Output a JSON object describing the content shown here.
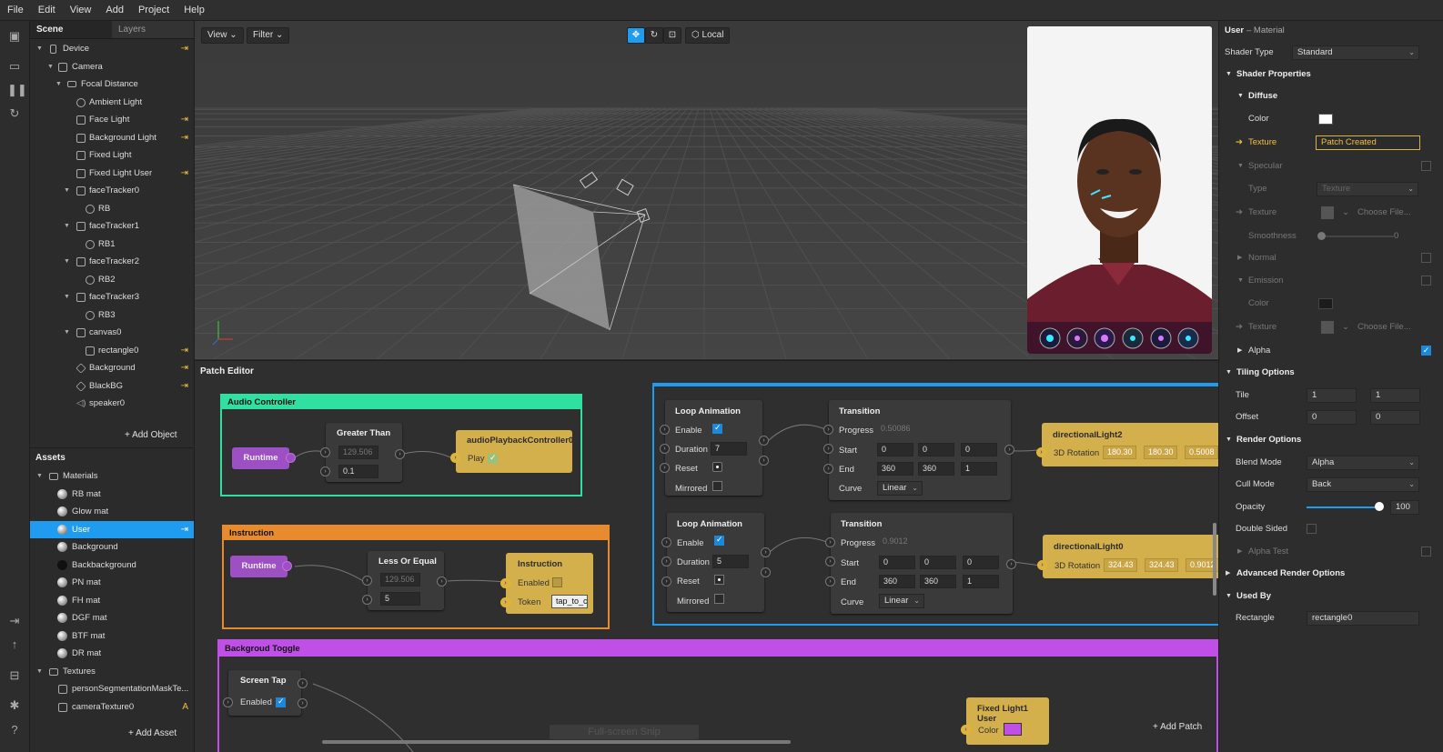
{
  "menu": [
    "File",
    "Edit",
    "View",
    "Add",
    "Project",
    "Help"
  ],
  "scene": {
    "tabs": [
      "Scene",
      "Layers"
    ],
    "items": [
      {
        "label": "Device",
        "pin": true
      },
      {
        "label": "Camera"
      },
      {
        "label": "Focal Distance"
      },
      {
        "label": "Ambient Light"
      },
      {
        "label": "Face Light",
        "pin": true
      },
      {
        "label": "Background Light",
        "pin": true
      },
      {
        "label": "Fixed Light"
      },
      {
        "label": "Fixed Light User",
        "pin": true
      },
      {
        "label": "faceTracker0"
      },
      {
        "label": "RB"
      },
      {
        "label": "faceTracker1"
      },
      {
        "label": "RB1"
      },
      {
        "label": "faceTracker2"
      },
      {
        "label": "RB2"
      },
      {
        "label": "faceTracker3"
      },
      {
        "label": "RB3"
      },
      {
        "label": "canvas0"
      },
      {
        "label": "rectangle0",
        "pin": true
      },
      {
        "label": "Background",
        "pin": true
      },
      {
        "label": "BlackBG",
        "pin": true
      },
      {
        "label": "speaker0"
      }
    ],
    "add_object": "Add Object"
  },
  "assets": {
    "title": "Assets",
    "materials_label": "Materials",
    "materials": [
      "RB mat",
      "Glow mat",
      "User",
      "Background",
      "Backbackground",
      "PN mat",
      "FH mat",
      "DGF mat",
      "BTF mat",
      "DR mat"
    ],
    "textures_label": "Textures",
    "textures": [
      "personSegmentationMaskTe...",
      "cameraTexture0"
    ],
    "texture_badge": "A",
    "add_asset": "Add Asset"
  },
  "viewport": {
    "view_label": "View",
    "filter_label": "Filter",
    "local_label": "Local"
  },
  "patch_editor": {
    "title": "Patch Editor",
    "add_patch": "Add Patch",
    "snip_label": "Full-screen Snip",
    "audio_group": {
      "title": "Audio Controller",
      "runtime": "Runtime",
      "greater_than": "Greater Than",
      "gt_value1": "129.506",
      "gt_value2": "0.1",
      "audio_node": "audioPlaybackController0",
      "play_label": "Play"
    },
    "instruction_group": {
      "title": "Instruction",
      "runtime": "Runtime",
      "less_or_equal": "Less Or Equal",
      "le_value1": "129.506",
      "le_value2": "5",
      "instruction_node": "Instruction",
      "enabled_label": "Enabled",
      "token_label": "Token",
      "token_value": "tap_to_c"
    },
    "toggle_group": {
      "title": "Backgroud Toggle",
      "screen_tap": "Screen Tap",
      "enabled_label": "Enabled",
      "fixed_light_node": "Fixed Light1 User",
      "color_label": "Color"
    },
    "anim_group": {
      "loop1": {
        "title": "Loop Animation",
        "enable": "Enable",
        "duration": "Duration",
        "duration_value": "7",
        "reset": "Reset",
        "mirrored": "Mirrored"
      },
      "trans1": {
        "title": "Transition",
        "progress": "Progress",
        "progress_value": "0.50086",
        "start": "Start",
        "start_values": [
          "0",
          "0",
          "0"
        ],
        "end": "End",
        "end_values": [
          "360",
          "360",
          "1"
        ],
        "curve": "Curve",
        "curve_value": "Linear"
      },
      "light1": {
        "title": "directionalLight2",
        "rotation": "3D Rotation",
        "values": [
          "180.30",
          "180.30",
          "0.5008"
        ]
      },
      "loop2": {
        "title": "Loop Animation",
        "enable": "Enable",
        "duration": "Duration",
        "duration_value": "5",
        "reset": "Reset",
        "mirrored": "Mirrored"
      },
      "trans2": {
        "title": "Transition",
        "progress": "Progress",
        "progress_value": "0.9012",
        "start": "Start",
        "start_values": [
          "0",
          "0",
          "0"
        ],
        "end": "End",
        "end_values": [
          "360",
          "360",
          "1"
        ],
        "curve": "Curve",
        "curve_value": "Linear"
      },
      "light2": {
        "title": "directionalLight0",
        "rotation": "3D Rotation",
        "values": [
          "324.43",
          "324.43",
          "0.9012"
        ]
      }
    }
  },
  "inspector": {
    "title": "User",
    "subtitle": "– Material",
    "shader_type_label": "Shader Type",
    "shader_type_value": "Standard",
    "shader_properties": "Shader Properties",
    "diffuse": "Diffuse",
    "color_label": "Color",
    "texture_label": "Texture",
    "texture_value": "Patch Created",
    "specular": "Specular",
    "type_label": "Type",
    "type_value": "Texture",
    "choose_file": "Choose File...",
    "smoothness_label": "Smoothness",
    "smoothness_value": "0",
    "normal": "Normal",
    "emission": "Emission",
    "alpha": "Alpha",
    "tiling_options": "Tiling Options",
    "tile_label": "Tile",
    "tile_values": [
      "1",
      "1"
    ],
    "offset_label": "Offset",
    "offset_values": [
      "0",
      "0"
    ],
    "render_options": "Render Options",
    "blend_mode_label": "Blend Mode",
    "blend_mode_value": "Alpha",
    "cull_mode_label": "Cull Mode",
    "cull_mode_value": "Back",
    "opacity_label": "Opacity",
    "opacity_value": "100",
    "opacity_fraction": 1.0,
    "double_sided_label": "Double Sided",
    "alpha_test": "Alpha Test",
    "advanced_render_options": "Advanced Render Options",
    "used_by": "Used By",
    "rectangle_label": "Rectangle",
    "rectangle_value": "rectangle0"
  },
  "colors": {
    "accent": "#1f9bf0",
    "audio_group": "#2fe0a0",
    "instruction_group": "#e88a2e",
    "toggle_group": "#c04fe8",
    "anim_group": "#1e9cf0",
    "patch_yellow": "#d4b04c",
    "patch_purple": "#9d4fc4"
  }
}
